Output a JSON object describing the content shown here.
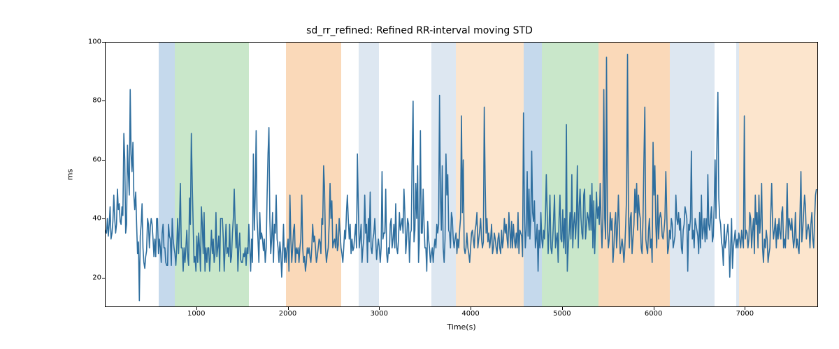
{
  "chart_data": {
    "type": "line",
    "title": "sd_rr_refined: Refined RR-interval moving STD",
    "xlabel": "Time(s)",
    "ylabel": "ms",
    "xlim": [
      0,
      7800
    ],
    "ylim": [
      10,
      100
    ],
    "x_ticks": [
      1000,
      2000,
      3000,
      4000,
      5000,
      6000,
      7000
    ],
    "y_ticks": [
      20,
      40,
      60,
      80,
      100
    ],
    "bands": [
      {
        "x0": 580,
        "x1": 760,
        "color": "#c5d9ec"
      },
      {
        "x0": 760,
        "x1": 1570,
        "color": "#c9e7ca"
      },
      {
        "x0": 1970,
        "x1": 2580,
        "color": "#fad9b9"
      },
      {
        "x0": 2770,
        "x1": 2990,
        "color": "#dde7f1"
      },
      {
        "x0": 3560,
        "x1": 3830,
        "color": "#dde7f1"
      },
      {
        "x0": 3830,
        "x1": 4570,
        "color": "#fce5cd"
      },
      {
        "x0": 4570,
        "x1": 4770,
        "color": "#c5d9ec"
      },
      {
        "x0": 4770,
        "x1": 5390,
        "color": "#c9e7ca"
      },
      {
        "x0": 5390,
        "x1": 6170,
        "color": "#fad9b9"
      },
      {
        "x0": 6170,
        "x1": 6660,
        "color": "#dde7f1"
      },
      {
        "x0": 6900,
        "x1": 6930,
        "color": "#dde7f1"
      },
      {
        "x0": 6930,
        "x1": 7800,
        "color": "#fce5cd"
      }
    ],
    "line_color": "#2e6e9e",
    "series": [
      {
        "name": "sd_rr_refined",
        "x_start": 0,
        "x_step": 10,
        "y": [
          36,
          35,
          40,
          34,
          38,
          44,
          33,
          35,
          39,
          48,
          40,
          35,
          38,
          50,
          43,
          45,
          39,
          38,
          44,
          41,
          69,
          60,
          35,
          38,
          65,
          55,
          48,
          84,
          62,
          56,
          66,
          48,
          43,
          49,
          38,
          28,
          32,
          12,
          34,
          38,
          45,
          30,
          25,
          23,
          27,
          29,
          40,
          38,
          30,
          37,
          40,
          38,
          33,
          27,
          33,
          27,
          40,
          40,
          28,
          33,
          30,
          25,
          35,
          38,
          30,
          30,
          25,
          24,
          24,
          38,
          34,
          33,
          24,
          40,
          33,
          30,
          28,
          24,
          30,
          40,
          28,
          38,
          52,
          30,
          30,
          22,
          30,
          25,
          30,
          36,
          27,
          24,
          47,
          38,
          69,
          52,
          38,
          25,
          27,
          22,
          34,
          25,
          35,
          30,
          22,
          44,
          38,
          28,
          42,
          22,
          30,
          25,
          30,
          30,
          22,
          28,
          36,
          28,
          33,
          25,
          28,
          42,
          27,
          30,
          34,
          22,
          40,
          40,
          40,
          33,
          22,
          30,
          38,
          28,
          30,
          27,
          38,
          25,
          27,
          35,
          40,
          50,
          38,
          30,
          38,
          22,
          30,
          35,
          26,
          25,
          25,
          28,
          27,
          30,
          24,
          30,
          28,
          38,
          30,
          22,
          33,
          25,
          62,
          36,
          48,
          70,
          40,
          33,
          25,
          42,
          33,
          35,
          33,
          29,
          33,
          25,
          30,
          48,
          62,
          71,
          40,
          28,
          33,
          42,
          25,
          38,
          35,
          48,
          33,
          30,
          25,
          32,
          28,
          20,
          28,
          38,
          25,
          30,
          25,
          30,
          33,
          22,
          48,
          33,
          25,
          30,
          36,
          38,
          25,
          30,
          28,
          30,
          25,
          30,
          33,
          48,
          30,
          25,
          27,
          22,
          25,
          30,
          28,
          30,
          27,
          25,
          30,
          38,
          32,
          34,
          30,
          25,
          27,
          30,
          33,
          32,
          28,
          40,
          38,
          58,
          50,
          30,
          25,
          28,
          30,
          38,
          52,
          40,
          46,
          30,
          32,
          33,
          30,
          38,
          29,
          31,
          40,
          35,
          30,
          28,
          25,
          30,
          36,
          33,
          42,
          48,
          40,
          33,
          38,
          28,
          33,
          29,
          30,
          34,
          38,
          30,
          62,
          44,
          30,
          33,
          38,
          25,
          30,
          33,
          48,
          35,
          38,
          25,
          40,
          32,
          49,
          30,
          28,
          33,
          35,
          40,
          33,
          26,
          30,
          33,
          30,
          25,
          30,
          56,
          33,
          35,
          35,
          50,
          28,
          25,
          30,
          28,
          38,
          40,
          30,
          33,
          38,
          30,
          45,
          30,
          28,
          33,
          42,
          36,
          38,
          40,
          35,
          50,
          42,
          28,
          33,
          40,
          38,
          25,
          35,
          36,
          62,
          80,
          32,
          36,
          52,
          40,
          58,
          25,
          33,
          70,
          35,
          35,
          50,
          38,
          30,
          30,
          22,
          39,
          33,
          30,
          25,
          28,
          30,
          25,
          30,
          33,
          30,
          38,
          35,
          38,
          82,
          48,
          36,
          58,
          30,
          25,
          33,
          62,
          48,
          55,
          36,
          35,
          30,
          42,
          40,
          33,
          30,
          33,
          35,
          28,
          33,
          30,
          36,
          40,
          75,
          42,
          60,
          30,
          28,
          30,
          35,
          30,
          28,
          25,
          30,
          35,
          36,
          33,
          30,
          36,
          38,
          42,
          30,
          33,
          36,
          40,
          33,
          30,
          32,
          78,
          52,
          35,
          40,
          32,
          35,
          30,
          33,
          38,
          28,
          30,
          35,
          33,
          30,
          28,
          33,
          35,
          30,
          28,
          36,
          30,
          33,
          40,
          35,
          38,
          33,
          30,
          42,
          36,
          30,
          39,
          30,
          38,
          33,
          30,
          35,
          30,
          42,
          28,
          36,
          35,
          34,
          27,
          76,
          44,
          30,
          36,
          56,
          34,
          50,
          33,
          40,
          63,
          42,
          39,
          46,
          30,
          33,
          38,
          22,
          36,
          30,
          42,
          33,
          30,
          36,
          33,
          40,
          55,
          42,
          28,
          36,
          48,
          30,
          28,
          33,
          40,
          48,
          30,
          33,
          35,
          25,
          40,
          48,
          33,
          32,
          43,
          30,
          40,
          28,
          72,
          22,
          30,
          35,
          42,
          33,
          55,
          30,
          38,
          42,
          33,
          40,
          58,
          30,
          44,
          50,
          40,
          35,
          33,
          48,
          50,
          33,
          38,
          42,
          40,
          36,
          48,
          36,
          52,
          30,
          46,
          28,
          38,
          49,
          40,
          44,
          38,
          52,
          39,
          30,
          40,
          84,
          40,
          33,
          95,
          38,
          30,
          33,
          42,
          36,
          40,
          25,
          30,
          38,
          42,
          30,
          36,
          48,
          38,
          28,
          30,
          33,
          30,
          25,
          30,
          38,
          48,
          96,
          42,
          30,
          40,
          42,
          28,
          33,
          38,
          50,
          42,
          52,
          36,
          48,
          42,
          40,
          30,
          28,
          40,
          60,
          78,
          33,
          30,
          28,
          36,
          40,
          30,
          33,
          25,
          66,
          48,
          58,
          38,
          30,
          48,
          33,
          40,
          42,
          40,
          34,
          33,
          36,
          40,
          56,
          42,
          28,
          30,
          36,
          33,
          40,
          38,
          30,
          32,
          34,
          48,
          40,
          38,
          42,
          36,
          40,
          30,
          28,
          36,
          38,
          44,
          42,
          40,
          22,
          38,
          36,
          40,
          63,
          33,
          36,
          30,
          40,
          38,
          36,
          34,
          28,
          42,
          30,
          48,
          33,
          36,
          40,
          32,
          40,
          33,
          55,
          38,
          36,
          40,
          44,
          32,
          34,
          44,
          60,
          40,
          67,
          83,
          47,
          40,
          38,
          32,
          30,
          24,
          38,
          30,
          32,
          35,
          38,
          32,
          20,
          30,
          40,
          23,
          30,
          33,
          36,
          30,
          33,
          30,
          35,
          33,
          30,
          36,
          33,
          30,
          75,
          33,
          36,
          35,
          30,
          33,
          42,
          40,
          30,
          36,
          40,
          28,
          48,
          38,
          42,
          30,
          48,
          35,
          40,
          52,
          30,
          25,
          33,
          30,
          36,
          33,
          25,
          28,
          30,
          42,
          52,
          38,
          33,
          36,
          40,
          30,
          38,
          33,
          40,
          35,
          33,
          42,
          44,
          30,
          33,
          30,
          38,
          52,
          33,
          40,
          38,
          36,
          40,
          34,
          30,
          33,
          42,
          30,
          33,
          30,
          28,
          42,
          56,
          32,
          36,
          42,
          48,
          44,
          33,
          36,
          38,
          36,
          30,
          38,
          42,
          33,
          30,
          40,
          48,
          50
        ]
      }
    ]
  }
}
